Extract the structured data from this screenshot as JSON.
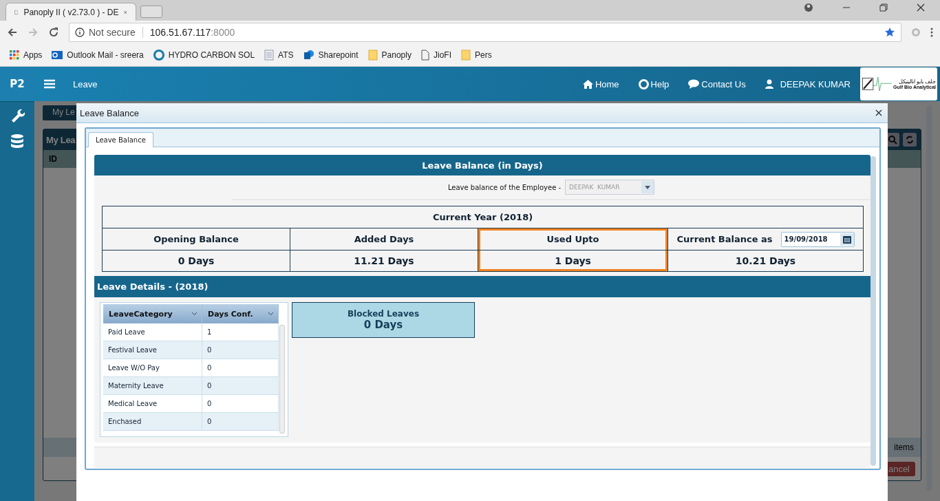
{
  "browser": {
    "tabs": [
      {
        "title": "Panoply II ( v2.73.0 ) - DE",
        "selected": true
      }
    ],
    "security": "Not secure",
    "url_host": "106.51.67.117",
    "url_port": ":8000",
    "bookmarks": [
      {
        "kind": "apps",
        "label": "Apps"
      },
      {
        "kind": "mail",
        "label": "Outlook Mail - sreera"
      },
      {
        "kind": "ring",
        "label": "HYDRO CARBON SOL"
      },
      {
        "kind": "doc",
        "label": "ATS"
      },
      {
        "kind": "share",
        "label": "Sharepoint"
      },
      {
        "kind": "folder",
        "label": "Panoply"
      },
      {
        "kind": "page",
        "label": "JioFI"
      },
      {
        "kind": "folder",
        "label": "Pers"
      }
    ]
  },
  "app": {
    "logo": "P2",
    "title": "Leave",
    "nav": [
      {
        "kind": "home",
        "label": "Home"
      },
      {
        "kind": "help",
        "label": "Help"
      },
      {
        "kind": "chat",
        "label": "Contact Us"
      },
      {
        "kind": "user",
        "label": "DEEPAK KUMAR"
      }
    ],
    "company_logo": {
      "arabic": "جلف بايو اناليتيكل",
      "name": "Gulf Bio Analytical"
    },
    "sidebar": [
      {
        "kind": "wrench"
      },
      {
        "kind": "database"
      }
    ]
  },
  "background": {
    "button": "My Le",
    "panel_title": "My Lea",
    "column": "ID",
    "footer": "items",
    "cancel": "ancel"
  },
  "modal": {
    "title": "Leave Balance",
    "tabs": [
      {
        "label": "Leave Balance",
        "selected": true
      }
    ],
    "heading": "Leave Balance (in Days)",
    "employee_label": "Leave balance of the Employee -",
    "employee_value": "DEEPAK  KUMAR",
    "employee_disabled": true,
    "year_heading": "Current Year (2018)",
    "summary": [
      {
        "label": "Opening Balance",
        "value": "0 Days",
        "highlighted": false
      },
      {
        "label": "Added Days",
        "value": "11.21 Days",
        "highlighted": false
      },
      {
        "label": "Used Upto",
        "value": "1 Days",
        "highlighted": true
      },
      {
        "label": "Current Balance as",
        "value": "10.21 Days",
        "highlighted": false,
        "date": "19/09/2018"
      }
    ],
    "details_heading": "Leave Details - (2018)",
    "table": {
      "columns": [
        "LeaveCategory",
        "Days Conf."
      ],
      "rows": [
        [
          "Paid Leave",
          "1"
        ],
        [
          "Festival Leave",
          "0"
        ],
        [
          "Leave W/O Pay",
          "0"
        ],
        [
          "Maternity Leave",
          "0"
        ],
        [
          "Medical Leave",
          "0"
        ],
        [
          "Enchased",
          "0"
        ]
      ]
    },
    "blocked": {
      "label": "Blocked Leaves",
      "value": "0 Days"
    }
  }
}
